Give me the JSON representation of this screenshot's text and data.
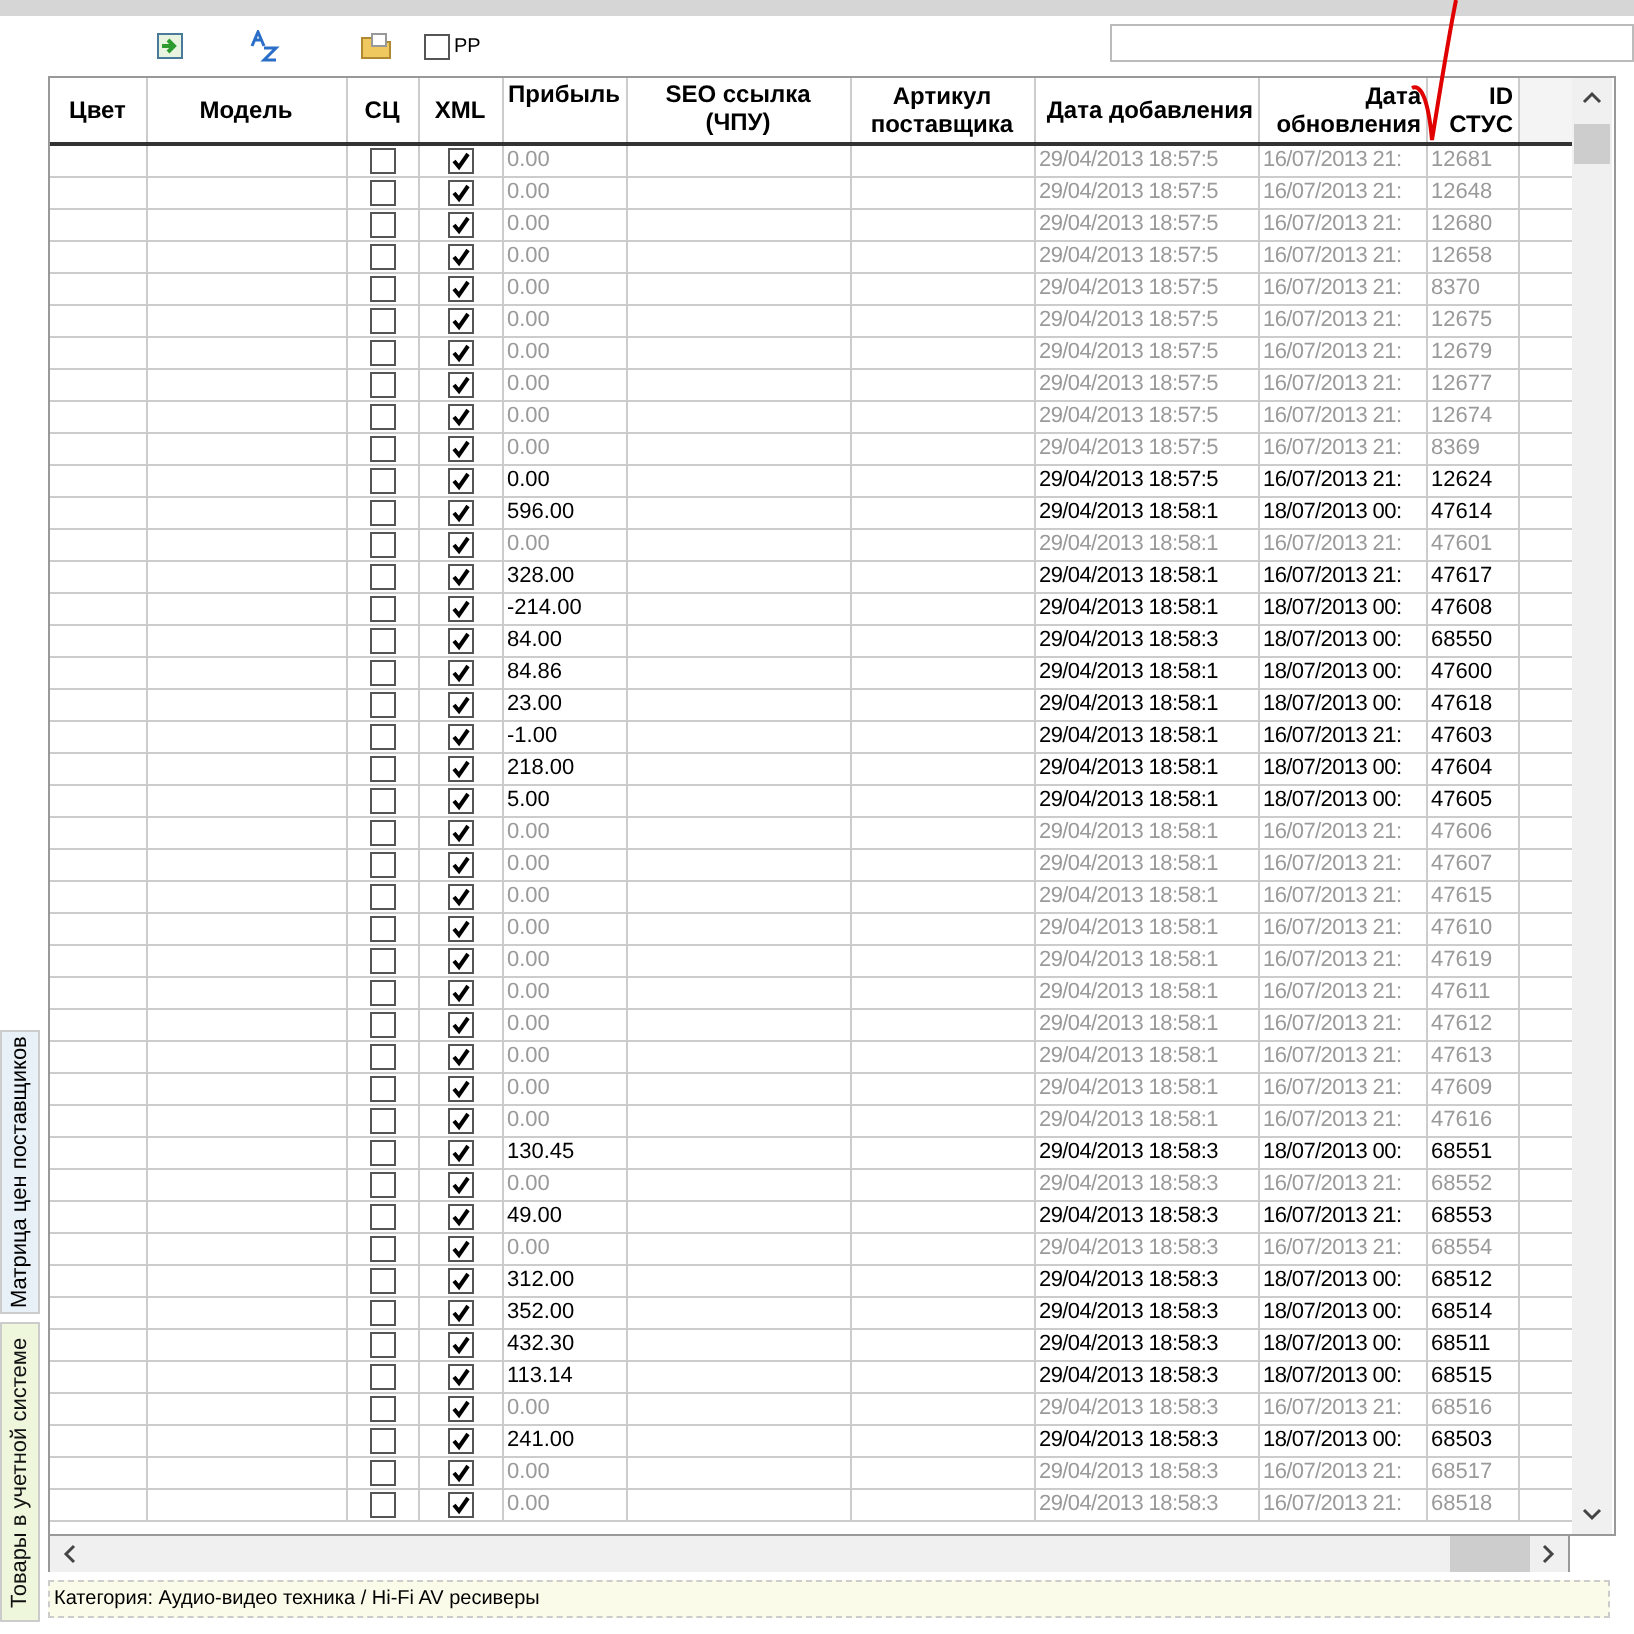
{
  "toolbar": {
    "pp_checkbox": {
      "label": "PP",
      "checked": false
    }
  },
  "side_tabs": [
    {
      "label": "Матрица цен поставщиков",
      "selected": true
    },
    {
      "label": "Товары в учетной системе",
      "selected": false
    }
  ],
  "table": {
    "columns": [
      "Цвет",
      "Модель",
      "СЦ",
      "XML",
      "Прибыль",
      "SEO ссылка (ЧПУ)",
      "Артикул поставщика",
      "Дата добавления",
      "Дата обновления",
      "ID СТУС"
    ],
    "rows": [
      {
        "sc": false,
        "xml": true,
        "profit": "0.00",
        "dimmed": true,
        "added": "29/04/2013 18:57:5",
        "updated": "16/07/2013 21:",
        "id": "12681"
      },
      {
        "sc": false,
        "xml": true,
        "profit": "0.00",
        "dimmed": true,
        "added": "29/04/2013 18:57:5",
        "updated": "16/07/2013 21:",
        "id": "12648"
      },
      {
        "sc": false,
        "xml": true,
        "profit": "0.00",
        "dimmed": true,
        "added": "29/04/2013 18:57:5",
        "updated": "16/07/2013 21:",
        "id": "12680"
      },
      {
        "sc": false,
        "xml": true,
        "profit": "0.00",
        "dimmed": true,
        "added": "29/04/2013 18:57:5",
        "updated": "16/07/2013 21:",
        "id": "12658"
      },
      {
        "sc": false,
        "xml": true,
        "profit": "0.00",
        "dimmed": true,
        "added": "29/04/2013 18:57:5",
        "updated": "16/07/2013 21:",
        "id": "8370"
      },
      {
        "sc": false,
        "xml": true,
        "profit": "0.00",
        "dimmed": true,
        "added": "29/04/2013 18:57:5",
        "updated": "16/07/2013 21:",
        "id": "12675"
      },
      {
        "sc": false,
        "xml": true,
        "profit": "0.00",
        "dimmed": true,
        "added": "29/04/2013 18:57:5",
        "updated": "16/07/2013 21:",
        "id": "12679"
      },
      {
        "sc": false,
        "xml": true,
        "profit": "0.00",
        "dimmed": true,
        "added": "29/04/2013 18:57:5",
        "updated": "16/07/2013 21:",
        "id": "12677"
      },
      {
        "sc": false,
        "xml": true,
        "profit": "0.00",
        "dimmed": true,
        "added": "29/04/2013 18:57:5",
        "updated": "16/07/2013 21:",
        "id": "12674"
      },
      {
        "sc": false,
        "xml": true,
        "profit": "0.00",
        "dimmed": true,
        "added": "29/04/2013 18:57:5",
        "updated": "16/07/2013 21:",
        "id": "8369"
      },
      {
        "sc": false,
        "xml": true,
        "profit": "0.00",
        "dimmed": false,
        "added": "29/04/2013 18:57:5",
        "updated": "16/07/2013 21:",
        "id": "12624"
      },
      {
        "sc": false,
        "xml": true,
        "profit": "596.00",
        "dimmed": false,
        "added": "29/04/2013 18:58:1",
        "updated": "18/07/2013 00:",
        "id": "47614"
      },
      {
        "sc": false,
        "xml": true,
        "profit": "0.00",
        "dimmed": true,
        "added": "29/04/2013 18:58:1",
        "updated": "16/07/2013 21:",
        "id": "47601"
      },
      {
        "sc": false,
        "xml": true,
        "profit": "328.00",
        "dimmed": false,
        "added": "29/04/2013 18:58:1",
        "updated": "16/07/2013 21:",
        "id": "47617"
      },
      {
        "sc": false,
        "xml": true,
        "profit": "-214.00",
        "dimmed": false,
        "added": "29/04/2013 18:58:1",
        "updated": "18/07/2013 00:",
        "id": "47608"
      },
      {
        "sc": false,
        "xml": true,
        "profit": "84.00",
        "dimmed": false,
        "added": "29/04/2013 18:58:3",
        "updated": "18/07/2013 00:",
        "id": "68550"
      },
      {
        "sc": false,
        "xml": true,
        "profit": "84.86",
        "dimmed": false,
        "added": "29/04/2013 18:58:1",
        "updated": "18/07/2013 00:",
        "id": "47600"
      },
      {
        "sc": false,
        "xml": true,
        "profit": "23.00",
        "dimmed": false,
        "added": "29/04/2013 18:58:1",
        "updated": "18/07/2013 00:",
        "id": "47618"
      },
      {
        "sc": false,
        "xml": true,
        "profit": "-1.00",
        "dimmed": false,
        "added": "29/04/2013 18:58:1",
        "updated": "16/07/2013 21:",
        "id": "47603"
      },
      {
        "sc": false,
        "xml": true,
        "profit": "218.00",
        "dimmed": false,
        "added": "29/04/2013 18:58:1",
        "updated": "18/07/2013 00:",
        "id": "47604"
      },
      {
        "sc": false,
        "xml": true,
        "profit": "5.00",
        "dimmed": false,
        "added": "29/04/2013 18:58:1",
        "updated": "18/07/2013 00:",
        "id": "47605"
      },
      {
        "sc": false,
        "xml": true,
        "profit": "0.00",
        "dimmed": true,
        "added": "29/04/2013 18:58:1",
        "updated": "16/07/2013 21:",
        "id": "47606"
      },
      {
        "sc": false,
        "xml": true,
        "profit": "0.00",
        "dimmed": true,
        "added": "29/04/2013 18:58:1",
        "updated": "16/07/2013 21:",
        "id": "47607"
      },
      {
        "sc": false,
        "xml": true,
        "profit": "0.00",
        "dimmed": true,
        "added": "29/04/2013 18:58:1",
        "updated": "16/07/2013 21:",
        "id": "47615"
      },
      {
        "sc": false,
        "xml": true,
        "profit": "0.00",
        "dimmed": true,
        "added": "29/04/2013 18:58:1",
        "updated": "16/07/2013 21:",
        "id": "47610"
      },
      {
        "sc": false,
        "xml": true,
        "profit": "0.00",
        "dimmed": true,
        "added": "29/04/2013 18:58:1",
        "updated": "16/07/2013 21:",
        "id": "47619"
      },
      {
        "sc": false,
        "xml": true,
        "profit": "0.00",
        "dimmed": true,
        "added": "29/04/2013 18:58:1",
        "updated": "16/07/2013 21:",
        "id": "47611"
      },
      {
        "sc": false,
        "xml": true,
        "profit": "0.00",
        "dimmed": true,
        "added": "29/04/2013 18:58:1",
        "updated": "16/07/2013 21:",
        "id": "47612"
      },
      {
        "sc": false,
        "xml": true,
        "profit": "0.00",
        "dimmed": true,
        "added": "29/04/2013 18:58:1",
        "updated": "16/07/2013 21:",
        "id": "47613"
      },
      {
        "sc": false,
        "xml": true,
        "profit": "0.00",
        "dimmed": true,
        "added": "29/04/2013 18:58:1",
        "updated": "16/07/2013 21:",
        "id": "47609"
      },
      {
        "sc": false,
        "xml": true,
        "profit": "0.00",
        "dimmed": true,
        "added": "29/04/2013 18:58:1",
        "updated": "16/07/2013 21:",
        "id": "47616"
      },
      {
        "sc": false,
        "xml": true,
        "profit": "130.45",
        "dimmed": false,
        "added": "29/04/2013 18:58:3",
        "updated": "18/07/2013 00:",
        "id": "68551"
      },
      {
        "sc": false,
        "xml": true,
        "profit": "0.00",
        "dimmed": true,
        "added": "29/04/2013 18:58:3",
        "updated": "16/07/2013 21:",
        "id": "68552"
      },
      {
        "sc": false,
        "xml": true,
        "profit": "49.00",
        "dimmed": false,
        "added": "29/04/2013 18:58:3",
        "updated": "16/07/2013 21:",
        "id": "68553"
      },
      {
        "sc": false,
        "xml": true,
        "profit": "0.00",
        "dimmed": true,
        "added": "29/04/2013 18:58:3",
        "updated": "16/07/2013 21:",
        "id": "68554"
      },
      {
        "sc": false,
        "xml": true,
        "profit": "312.00",
        "dimmed": false,
        "added": "29/04/2013 18:58:3",
        "updated": "18/07/2013 00:",
        "id": "68512"
      },
      {
        "sc": false,
        "xml": true,
        "profit": "352.00",
        "dimmed": false,
        "added": "29/04/2013 18:58:3",
        "updated": "18/07/2013 00:",
        "id": "68514"
      },
      {
        "sc": false,
        "xml": true,
        "profit": "432.30",
        "dimmed": false,
        "added": "29/04/2013 18:58:3",
        "updated": "18/07/2013 00:",
        "id": "68511"
      },
      {
        "sc": false,
        "xml": true,
        "profit": "113.14",
        "dimmed": false,
        "added": "29/04/2013 18:58:3",
        "updated": "18/07/2013 00:",
        "id": "68515"
      },
      {
        "sc": false,
        "xml": true,
        "profit": "0.00",
        "dimmed": true,
        "added": "29/04/2013 18:58:3",
        "updated": "16/07/2013 21:",
        "id": "68516"
      },
      {
        "sc": false,
        "xml": true,
        "profit": "241.00",
        "dimmed": false,
        "added": "29/04/2013 18:58:3",
        "updated": "18/07/2013 00:",
        "id": "68503"
      },
      {
        "sc": false,
        "xml": true,
        "profit": "0.00",
        "dimmed": true,
        "added": "29/04/2013 18:58:3",
        "updated": "16/07/2013 21:",
        "id": "68517"
      },
      {
        "sc": false,
        "xml": true,
        "profit": "0.00",
        "dimmed": true,
        "added": "29/04/2013 18:58:3",
        "updated": "16/07/2013 21:",
        "id": "68518"
      }
    ]
  },
  "status_bar": "Категория: Аудио-видео техника / Hi-Fi AV ресиверы"
}
